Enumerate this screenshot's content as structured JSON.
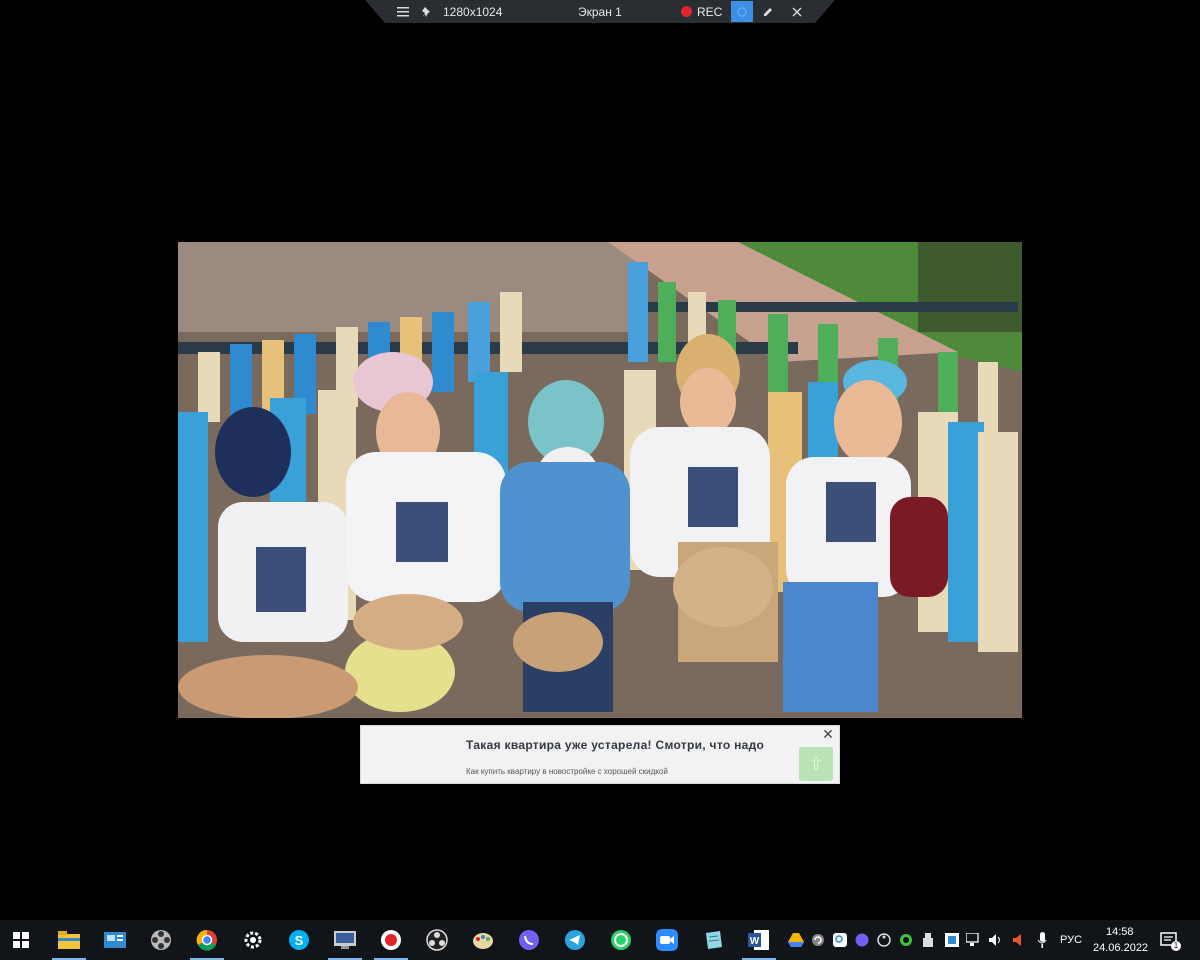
{
  "recorder_toolbar": {
    "resolution": "1280x1024",
    "screen_label": "Экран 1",
    "rec_label": "REC",
    "icons": [
      "menu-icon",
      "pin-icon",
      "record-icon",
      "select-icon",
      "pen-icon",
      "close-icon"
    ],
    "rec_color": "#e0242c",
    "active_color": "#3d8fe6"
  },
  "ad": {
    "title": "Такая квартира уже устарела! Смотри, что надо",
    "subtitle": "Как купить квартиру в новостройке с хорошей скидкой",
    "close_glyph": "✕",
    "button_glyph": "⇧"
  },
  "taskbar": {
    "pinned_apps": [
      "windows-start",
      "file-explorer",
      "control-panel",
      "media-player",
      "chrome",
      "settings",
      "skype",
      "screen-recorder-window",
      "record-app",
      "obs-studio",
      "paint-app",
      "viber",
      "telegram",
      "whatsapp",
      "zoom",
      "notes-app",
      "word"
    ],
    "tray_icons": [
      "google-drive-icon",
      "sync-icon",
      "search-app-icon",
      "viber-tray-icon",
      "obs-tray-icon",
      "green-circle-icon",
      "usb-icon",
      "app-tray-icon",
      "network-icon",
      "volume-icon",
      "speaker-muted-icon",
      "microphone-icon"
    ],
    "language": "РУС",
    "time": "14:58",
    "date": "24.06.2022",
    "notification_count": "1"
  }
}
